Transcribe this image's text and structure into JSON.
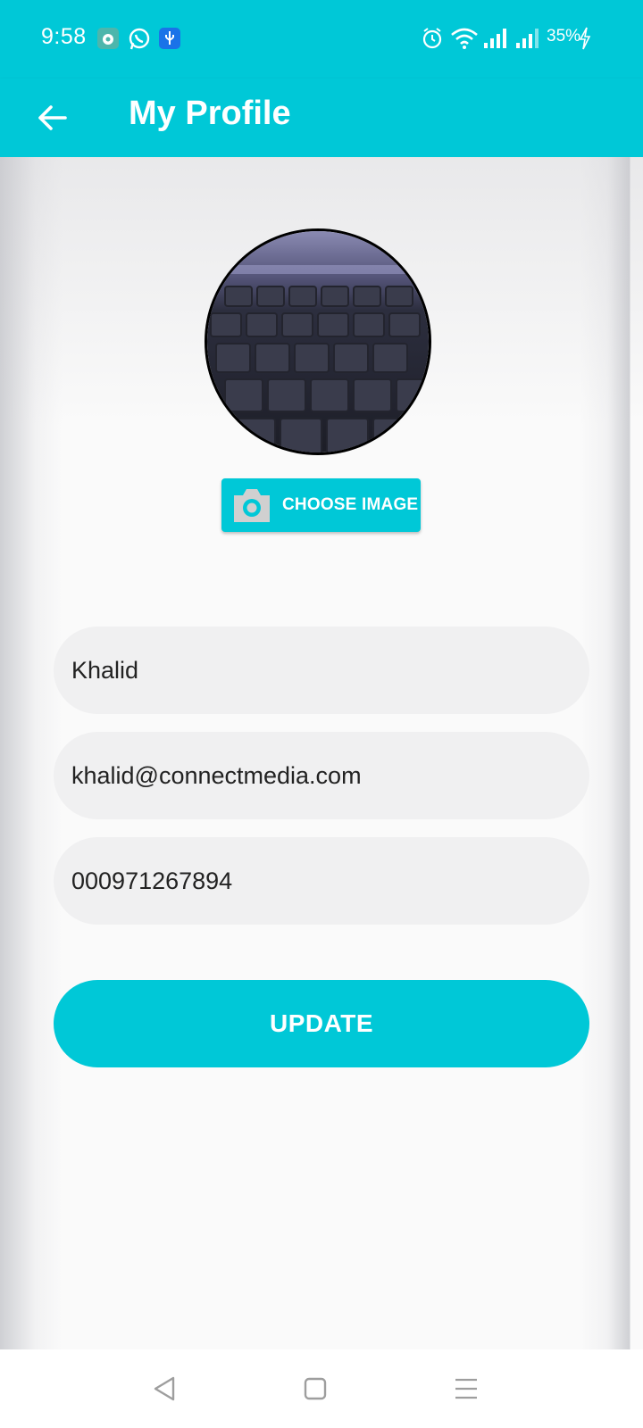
{
  "status_bar": {
    "time": "9:58",
    "battery": "35%",
    "notification_icons": [
      "android-app-icon",
      "whatsapp-icon",
      "usb-icon"
    ],
    "system_icons": [
      "alarm-icon",
      "wifi-icon",
      "signal-icon",
      "signal-icon",
      "battery-charging-icon"
    ]
  },
  "app_bar": {
    "title": "My Profile",
    "back_icon": "arrow-left-icon"
  },
  "profile": {
    "avatar_alt": "profile photo",
    "choose_image_label": "CHOOSE IMAGE",
    "choose_image_icon": "camera-icon"
  },
  "form": {
    "name": "Khalid",
    "email": "khalid@connectmedia.com",
    "phone": "000971267894",
    "update_label": "UPDATE"
  },
  "nav_bar": {
    "icons": [
      "back-triangle-icon",
      "home-square-icon",
      "menu-lines-icon"
    ]
  },
  "colors": {
    "accent": "#00c8d7",
    "field_bg": "#f0f0f1",
    "page_bg": "#fafafa"
  }
}
